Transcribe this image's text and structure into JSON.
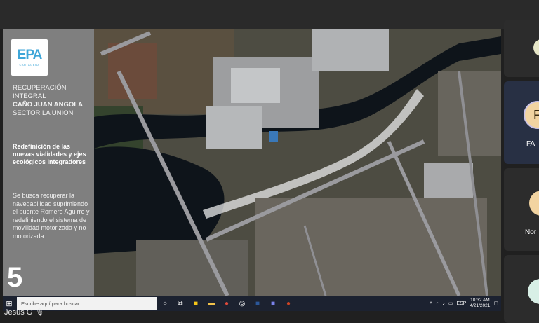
{
  "slide": {
    "logo_text": "EPA",
    "logo_sub": "CARTAGENA",
    "title_line1": "RECUPERACIÓN",
    "title_line2": "INTEGRAL",
    "title_line3": "CAÑO JUAN ANGOLA",
    "title_line4": "SECTOR LA UNION",
    "subtitle": "Redefinición de las nuevas vialidades y ejes ecológicos integradores",
    "body": "Se busca recuperar la navegabilidad suprimiendo el puente Romero Aguirre y redefiniendo el sistema de movilidad motorizada y no motorizada",
    "number": "5"
  },
  "taskbar": {
    "search_placeholder": "Escribe aquí para buscar",
    "language": "ESP",
    "time": "10:32 AM",
    "date": "4/21/2021"
  },
  "participant": {
    "name": "Jesus G"
  },
  "sidebar": {
    "tile2_initial": "F",
    "tile2_label": "FA",
    "tile3_label": "Nor"
  },
  "colors": {
    "accent_logo": "#3ea6d8",
    "slide_panel": "#7f7f7f",
    "highlight_tile": "#283044"
  }
}
